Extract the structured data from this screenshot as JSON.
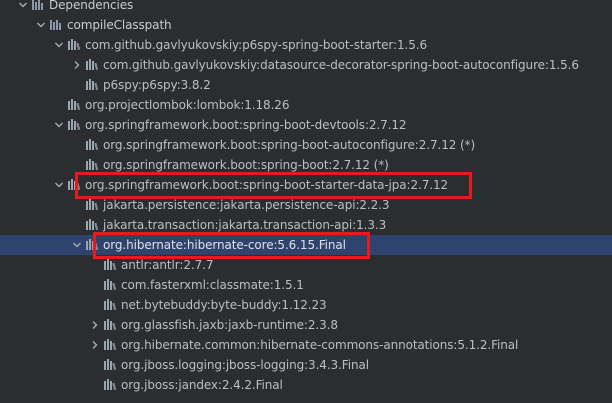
{
  "tree": {
    "rows": [
      {
        "label": "Dependencies",
        "depth": 0,
        "expander": "expanded",
        "icon": "folder-icon",
        "kind": "root"
      },
      {
        "label": "compileClasspath",
        "depth": 1,
        "expander": "expanded",
        "icon": "folder-icon",
        "kind": "root"
      },
      {
        "label": "com.github.gavlyukovskiy:p6spy-spring-boot-starter:1.5.6",
        "depth": 2,
        "expander": "expanded",
        "icon": "library-icon"
      },
      {
        "label": "com.github.gavlyukovskiy:datasource-decorator-spring-boot-autoconfigure:1.5.6",
        "depth": 3,
        "expander": "collapsed",
        "icon": "library-icon"
      },
      {
        "label": "p6spy:p6spy:3.8.2",
        "depth": 3,
        "expander": "none",
        "icon": "library-icon"
      },
      {
        "label": "org.projectlombok:lombok:1.18.26",
        "depth": 2,
        "expander": "none",
        "icon": "library-icon"
      },
      {
        "label": "org.springframework.boot:spring-boot-devtools:2.7.12",
        "depth": 2,
        "expander": "expanded",
        "icon": "library-icon"
      },
      {
        "label": "org.springframework.boot:spring-boot-autoconfigure:2.7.12",
        "suffix": " (*)",
        "depth": 3,
        "expander": "none",
        "icon": "library-icon"
      },
      {
        "label": "org.springframework.boot:spring-boot:2.7.12",
        "suffix": " (*)",
        "depth": 3,
        "expander": "none",
        "icon": "library-icon"
      },
      {
        "label": "org.springframework.boot:spring-boot-starter-data-jpa:2.7.12",
        "depth": 2,
        "expander": "expanded",
        "icon": "library-icon"
      },
      {
        "label": "jakarta.persistence:jakarta.persistence-api:2.2.3",
        "depth": 3,
        "expander": "none",
        "icon": "library-icon"
      },
      {
        "label": "jakarta.transaction:jakarta.transaction-api:1.3.3",
        "depth": 3,
        "expander": "none",
        "icon": "library-icon"
      },
      {
        "label": "org.hibernate:hibernate-core:5.6.15.Final",
        "depth": 3,
        "expander": "expanded",
        "icon": "library-icon",
        "selected": true
      },
      {
        "label": "antlr:antlr:2.7.7",
        "depth": 4,
        "expander": "none",
        "icon": "library-icon"
      },
      {
        "label": "com.fasterxml:classmate:1.5.1",
        "depth": 4,
        "expander": "none",
        "icon": "library-icon"
      },
      {
        "label": "net.bytebuddy:byte-buddy:1.12.23",
        "depth": 4,
        "expander": "none",
        "icon": "library-icon"
      },
      {
        "label": "org.glassfish.jaxb:jaxb-runtime:2.3.8",
        "depth": 4,
        "expander": "collapsed",
        "icon": "library-icon"
      },
      {
        "label": "org.hibernate.common:hibernate-commons-annotations:5.1.2.Final",
        "depth": 4,
        "expander": "collapsed",
        "icon": "library-icon"
      },
      {
        "label": "org.jboss.logging:jboss-logging:3.4.3.Final",
        "depth": 4,
        "expander": "none",
        "icon": "library-icon"
      },
      {
        "label": "org.jboss:jandex:2.4.2.Final",
        "depth": 4,
        "expander": "none",
        "icon": "library-icon"
      }
    ]
  },
  "highlights": [
    {
      "target_row": 9
    },
    {
      "target_row": 12
    }
  ],
  "colors": {
    "background": "#2b2d30",
    "text": "#bcbec4",
    "selection": "#2e436e",
    "highlight_border": "#e41b1b",
    "folder_icon": "#8b97ab",
    "library_icon": "#9aa7b0"
  }
}
